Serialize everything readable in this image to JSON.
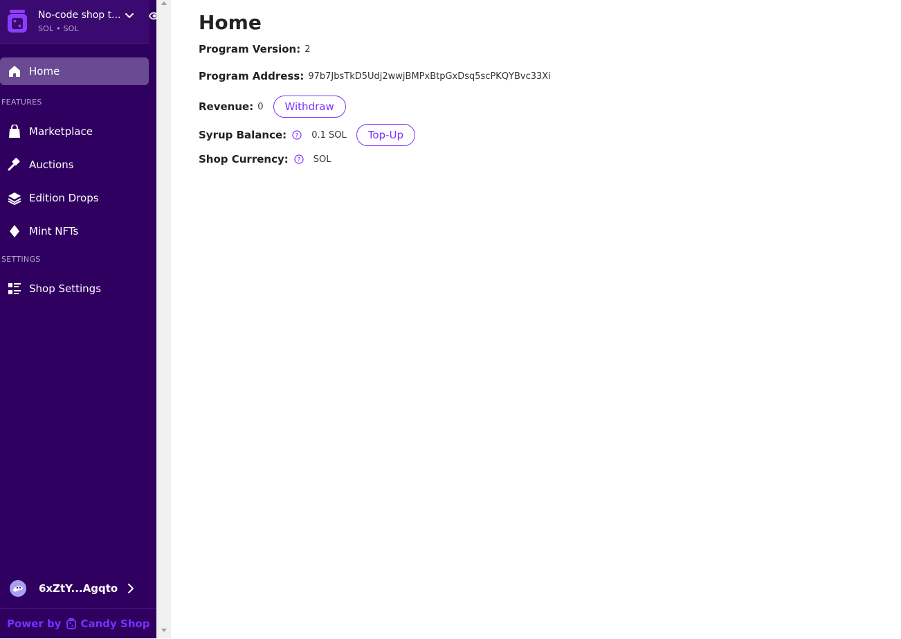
{
  "sidebar": {
    "shop_name": "No-code shop t...",
    "shop_sub": "SOL • SOL",
    "items": [
      {
        "label": "Home"
      },
      {
        "label": "Marketplace"
      },
      {
        "label": "Auctions"
      },
      {
        "label": "Edition Drops"
      },
      {
        "label": "Mint NFTs"
      },
      {
        "label": "Shop Settings"
      }
    ],
    "sections": {
      "features": "FEATURES",
      "settings": "SETTINGS"
    },
    "wallet": "6xZtY...Agqto",
    "power_by": "Power by",
    "brand": "Candy Shop"
  },
  "main": {
    "title": "Home",
    "program_version_label": "Program Version:",
    "program_version": "2",
    "program_address_label": "Program Address:",
    "program_address": "97b7JbsTkD5Udj2wwjBMPxBtpGxDsq5scPKQYBvc33Xi",
    "revenue_label": "Revenue:",
    "revenue": "0",
    "withdraw_label": "Withdraw",
    "syrup_label": "Syrup Balance:",
    "syrup_value": "0.1 SOL",
    "topup_label": "Top-Up",
    "currency_label": "Shop Currency:",
    "currency_value": "SOL"
  },
  "colors": {
    "sidebar_bg": "#300060",
    "active_bg": "#6a4a93",
    "accent": "#7b2fff"
  }
}
